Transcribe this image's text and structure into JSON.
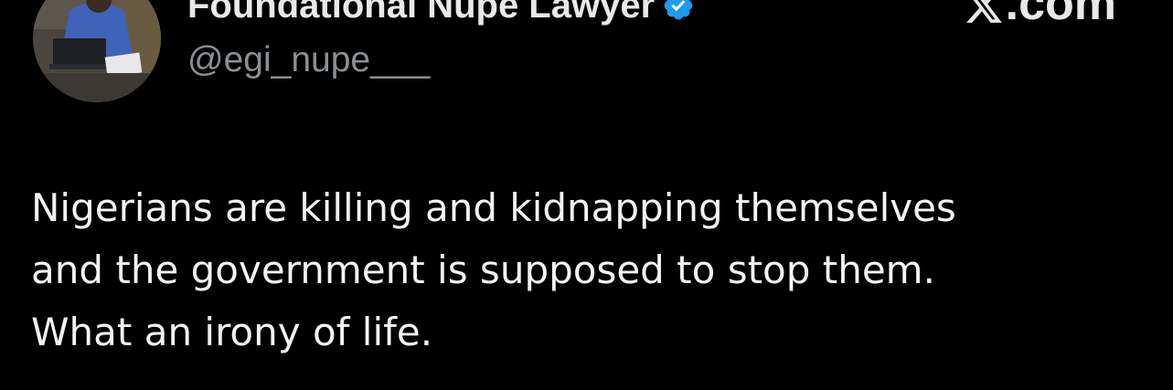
{
  "author": {
    "display_name": "Foundational Nupe Lawyer",
    "handle": "@egi_nupe___",
    "verified": true,
    "badge_color": "#1d9bf0"
  },
  "watermark": {
    "text": ".com",
    "icon": "x-logo-icon"
  },
  "tweet": {
    "lines": [
      "Nigerians are killing and kidnapping themselves",
      "and the government is supposed to stop them.",
      "What an irony of life."
    ]
  },
  "colors": {
    "background": "#000000",
    "primary_text": "#e7e9ea",
    "secondary_text": "#8b8f93"
  }
}
